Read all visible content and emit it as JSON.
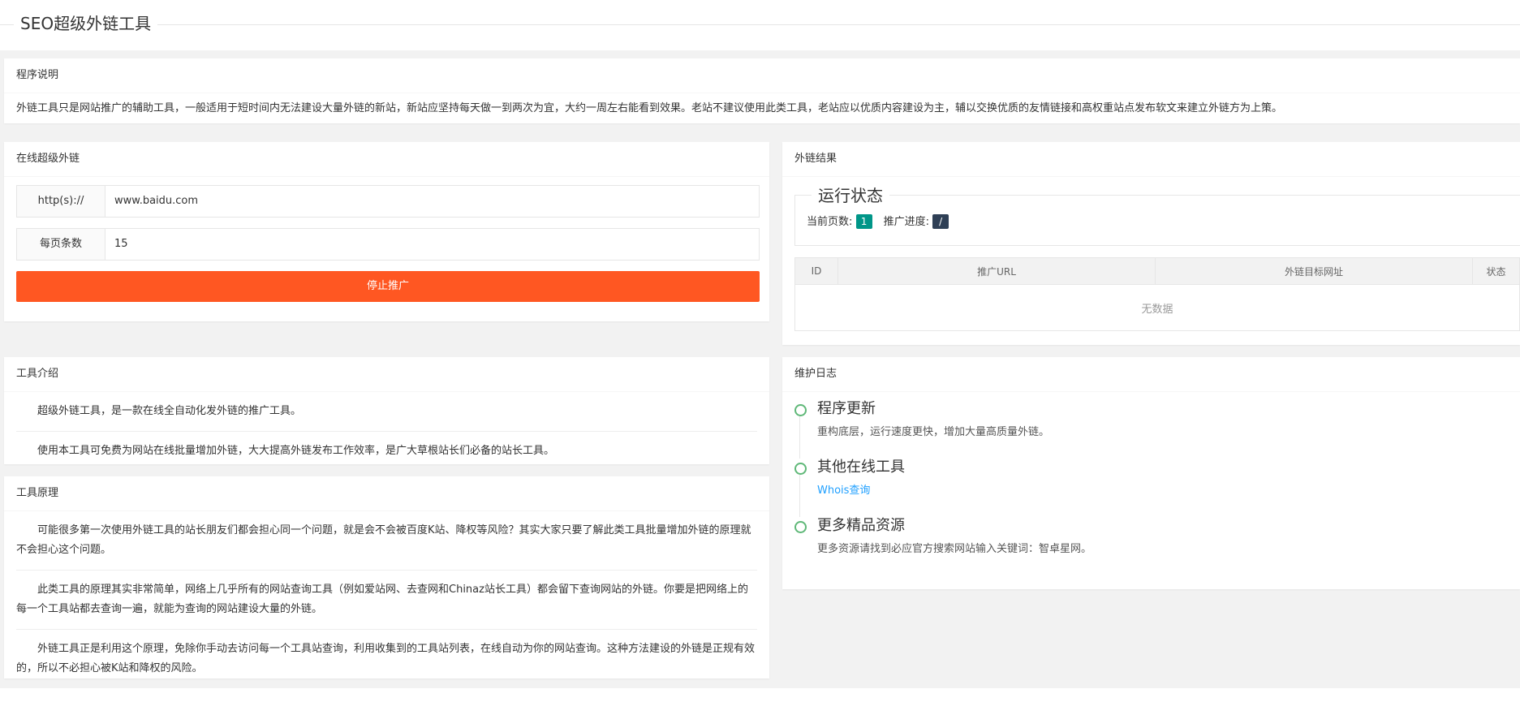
{
  "page": {
    "title": "SEO超级外链工具"
  },
  "program": {
    "header": "程序说明",
    "text": "外链工具只是网站推广的辅助工具，一般适用于短时间内无法建设大量外链的新站，新站应坚持每天做一到两次为宜，大约一周左右能看到效果。老站不建议使用此类工具，老站应以优质内容建设为主，辅以交换优质的友情链接和高权重站点发布软文来建立外链方为上策。"
  },
  "online": {
    "header": "在线超级外链",
    "url_label": "http(s)://",
    "url_value": "www.baidu.com",
    "per_page_label": "每页条数",
    "per_page_value": "15",
    "stop_label": "停止推广"
  },
  "result": {
    "header": "外链结果",
    "status_legend": "运行状态",
    "current_page_label": "当前页数:",
    "current_page_value": "1",
    "progress_label": "推广进度:",
    "progress_value": "/",
    "columns": [
      "ID",
      "推广URL",
      "外链目标网址",
      "状态"
    ],
    "empty": "无数据",
    "colors": {
      "page_badge": "#009688",
      "progress_badge": "#2F4056"
    }
  },
  "intro": {
    "header": "工具介绍",
    "paragraphs": [
      "超级外链工具，是一款在线全自动化发外链的推广工具。",
      "使用本工具可免费为网站在线批量增加外链，大大提高外链发布工作效率，是广大草根站长们必备的站长工具。"
    ]
  },
  "principle": {
    "header": "工具原理",
    "paragraphs": [
      "可能很多第一次使用外链工具的站长朋友们都会担心同一个问题，就是会不会被百度K站、降权等风险？其实大家只要了解此类工具批量增加外链的原理就不会担心这个问题。",
      "此类工具的原理其实非常简单，网络上几乎所有的网站查询工具（例如爱站网、去查网和Chinaz站长工具）都会留下查询网站的外链。你要是把网络上的每一个工具站都去查询一遍，就能为查询的网站建设大量的外链。",
      "外链工具正是利用这个原理，免除你手动去访问每一个工具站查询，利用收集到的工具站列表，在线自动为你的网站查询。这种方法建设的外链是正规有效的，所以不必担心被K站和降权的风险。"
    ]
  },
  "log": {
    "header": "维护日志",
    "items": [
      {
        "title": "程序更新",
        "text": "重构底层，运行速度更快，增加大量高质量外链。"
      },
      {
        "title": "其他在线工具",
        "link": "Whois查询"
      },
      {
        "title": "更多精品资源",
        "text": "更多资源请找到必应官方搜索网站输入关键词：智卓星网。"
      }
    ]
  },
  "colors": {
    "accent": "#ff5722",
    "timeline": "#5FB878",
    "link": "#1E9FFF"
  }
}
